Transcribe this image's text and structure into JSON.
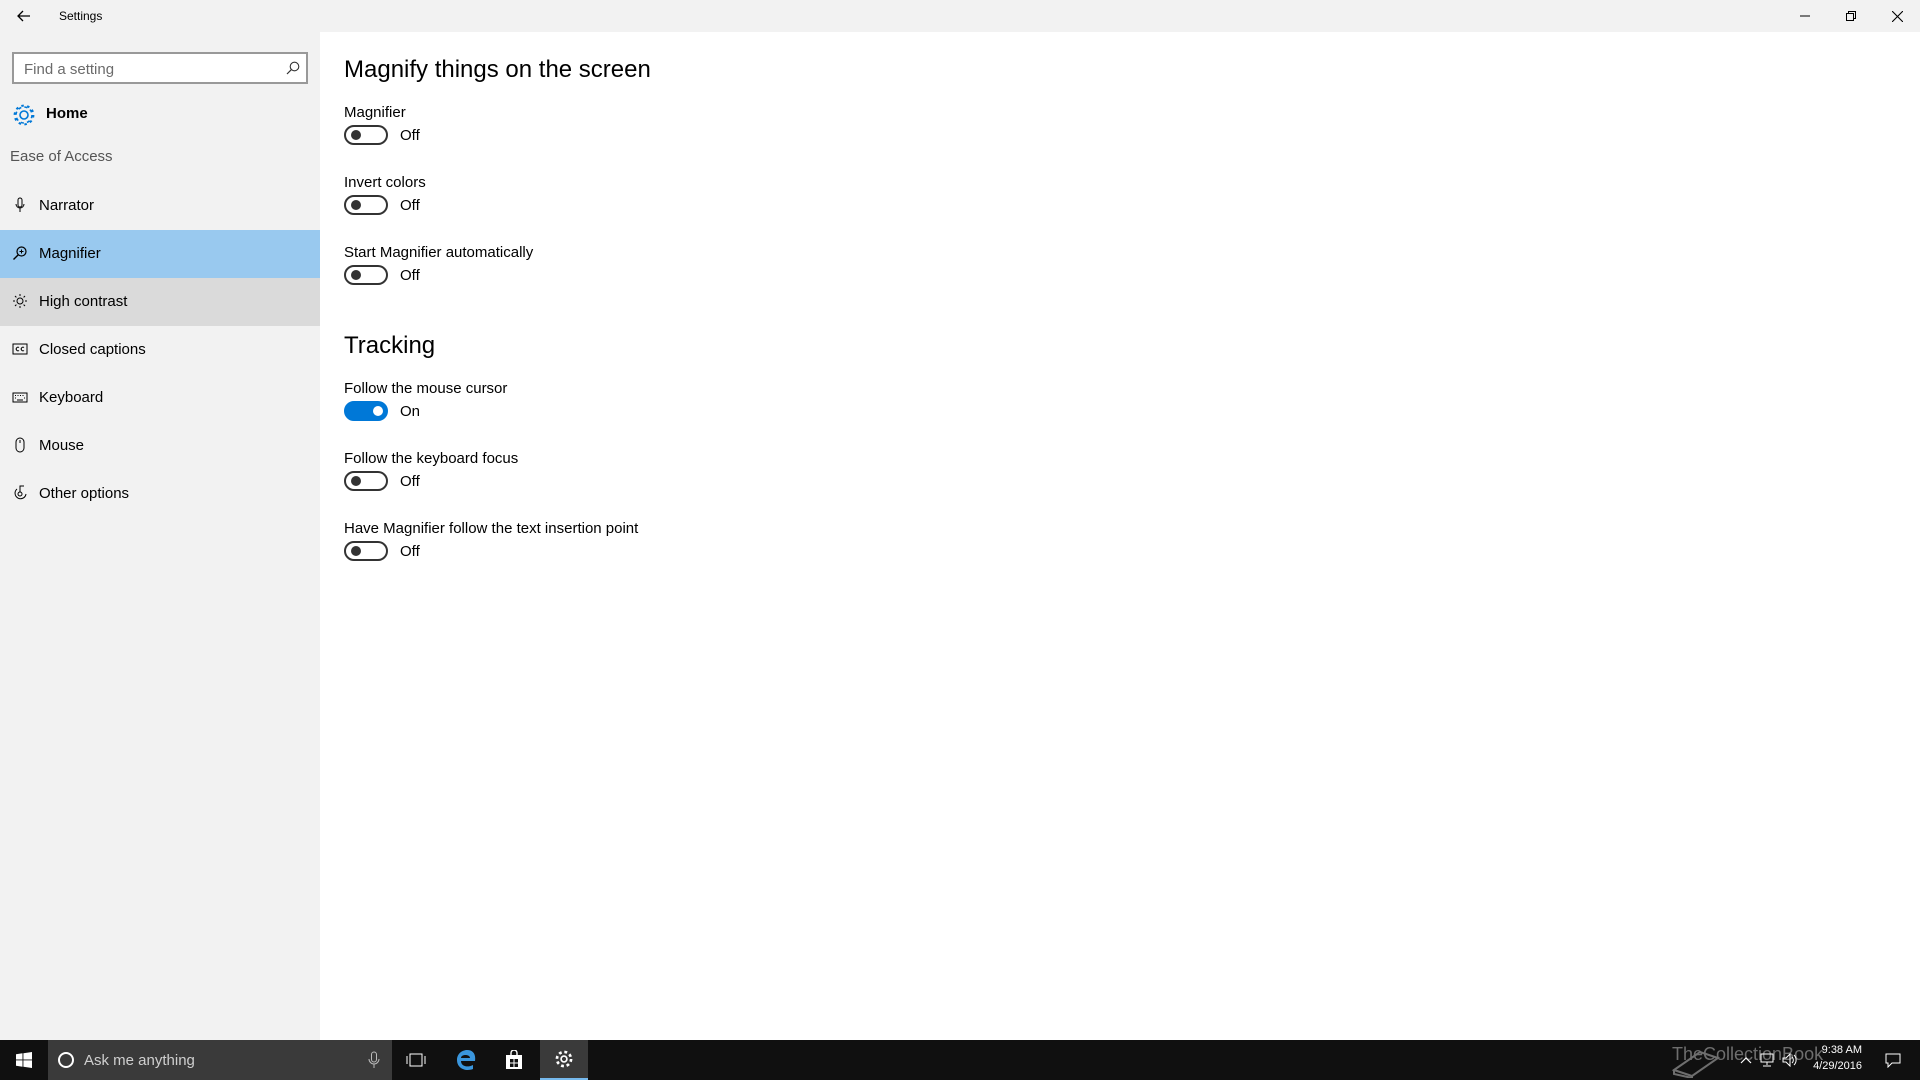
{
  "window": {
    "title": "Settings"
  },
  "sidebar": {
    "search_placeholder": "Find a setting",
    "home_label": "Home",
    "category": "Ease of Access",
    "items": [
      {
        "label": "Narrator",
        "icon": "narrator-icon"
      },
      {
        "label": "Magnifier",
        "icon": "magnifier-icon",
        "selected": true
      },
      {
        "label": "High contrast",
        "icon": "brightness-icon",
        "hover": true
      },
      {
        "label": "Closed captions",
        "icon": "captions-icon"
      },
      {
        "label": "Keyboard",
        "icon": "keyboard-icon"
      },
      {
        "label": "Mouse",
        "icon": "mouse-icon"
      },
      {
        "label": "Other options",
        "icon": "other-options-icon"
      }
    ]
  },
  "main": {
    "heading": "Magnify things on the screen",
    "settings": [
      {
        "label": "Magnifier",
        "state": "Off",
        "on": false
      },
      {
        "label": "Invert colors",
        "state": "Off",
        "on": false
      },
      {
        "label": "Start Magnifier automatically",
        "state": "Off",
        "on": false
      }
    ],
    "tracking_heading": "Tracking",
    "tracking": [
      {
        "label": "Follow the mouse cursor",
        "state": "On",
        "on": true
      },
      {
        "label": "Follow the keyboard focus",
        "state": "Off",
        "on": false
      },
      {
        "label": "Have Magnifier follow the text insertion point",
        "state": "Off",
        "on": false
      }
    ]
  },
  "taskbar": {
    "search_placeholder": "Ask me anything",
    "watermark": "TheCollectionBook",
    "time": "9:38 AM",
    "date": "4/29/2016"
  },
  "colors": {
    "accent": "#0078d7",
    "selected_nav": "#99c9ef",
    "sidebar_bg": "#f2f2f2",
    "taskbar_bg": "#101010"
  }
}
